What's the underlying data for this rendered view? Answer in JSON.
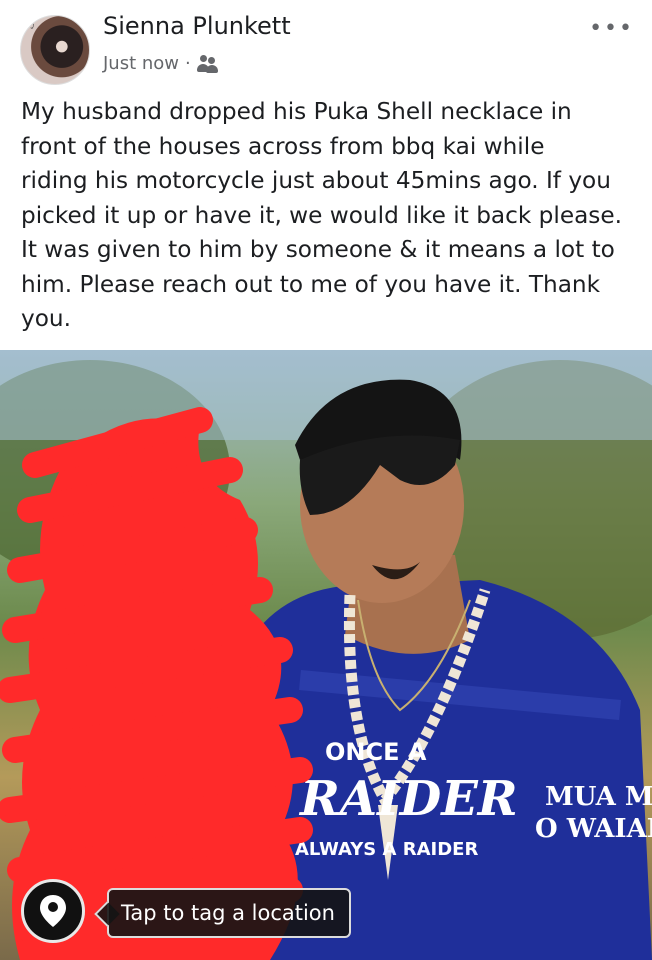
{
  "post": {
    "author": "Sienna Plunkett",
    "avatar_script": "Sienna",
    "timestamp": "Just now",
    "separator": "·",
    "audience_icon": "friends-icon",
    "more_icon": "more-options-icon",
    "more_label": "•••",
    "text": "My husband dropped his Puka Shell necklace in\nfront of the houses across from bbq kai while\nriding his motorcycle just about 45mins ago. If you\npicked it up or have it, we would like it back please.\nIt was given to him by someone & it means a lot to\nhim. Please reach out to me of you have it. Thank\nyou."
  },
  "photo": {
    "shirt_text_1": "ONCE A",
    "shirt_text_2": "RAIDER",
    "shirt_text_3": "ALWAYS A RAIDER",
    "shirt_text_4": "MUA MĀ",
    "shirt_text_5": "O WAIAN",
    "tag_location_label": "Tap to tag a location",
    "pin_icon": "location-pin-icon"
  },
  "colors": {
    "text": "#1c1e21",
    "secondary": "#65676b",
    "redaction": "#ff2a2a",
    "shirt": "#1f2f9a"
  }
}
